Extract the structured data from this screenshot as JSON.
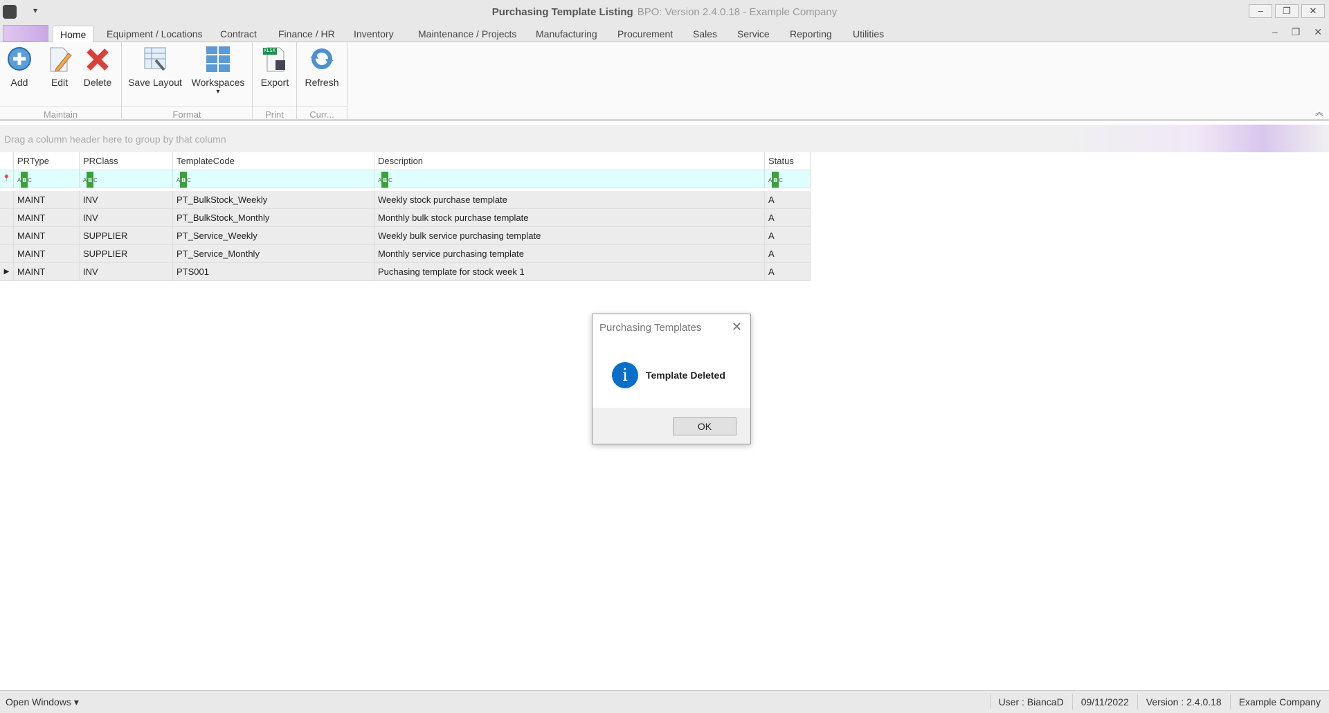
{
  "window": {
    "title": "Purchasing Template Listing",
    "subtitle": "BPO: Version 2.4.0.18 - Example Company",
    "minimize": "–",
    "restore": "❐",
    "close": "✕",
    "qat": "▾"
  },
  "tabs": [
    "Home",
    "Equipment / Locations",
    "Contract",
    "Finance / HR",
    "Inventory",
    "Maintenance / Projects",
    "Manufacturing",
    "Procurement",
    "Sales",
    "Service",
    "Reporting",
    "Utilities"
  ],
  "mdi": {
    "minimize": "–",
    "restore": "❐",
    "close": "✕"
  },
  "ribbon": {
    "buttons": {
      "add": "Add",
      "edit": "Edit",
      "delete": "Delete",
      "save_layout": "Save Layout",
      "workspaces": "Workspaces",
      "export": "Export",
      "refresh": "Refresh"
    },
    "groups": {
      "maintain": "Maintain",
      "format": "Format",
      "print": "Print",
      "curr": "Curr..."
    },
    "export_badge": "XLSX"
  },
  "grid": {
    "group_panel": "Drag a column header here to group by that column",
    "columns": [
      "PRType",
      "PRClass",
      "TemplateCode",
      "Description",
      "Status"
    ],
    "rows": [
      [
        "MAINT",
        "INV",
        "PT_BulkStock_Weekly",
        "Weekly stock purchase template",
        "A"
      ],
      [
        "MAINT",
        "INV",
        "PT_BulkStock_Monthly",
        "Monthly bulk stock purchase template",
        "A"
      ],
      [
        "MAINT",
        "SUPPLIER",
        "PT_Service_Weekly",
        "Weekly bulk service purchasing template",
        "A"
      ],
      [
        "MAINT",
        "SUPPLIER",
        "PT_Service_Monthly",
        "Monthly service purchasing template",
        "A"
      ],
      [
        "MAINT",
        "INV",
        "PTS001",
        "Puchasing template for stock week 1",
        "A"
      ]
    ]
  },
  "dialog": {
    "title": "Purchasing Templates",
    "message": "Template Deleted",
    "ok": "OK",
    "close": "✕",
    "icon": "i"
  },
  "statusbar": {
    "open_windows": "Open Windows ▾",
    "user": "User : BiancaD",
    "date": "09/11/2022",
    "version": "Version : 2.4.0.18",
    "company": "Example Company"
  }
}
